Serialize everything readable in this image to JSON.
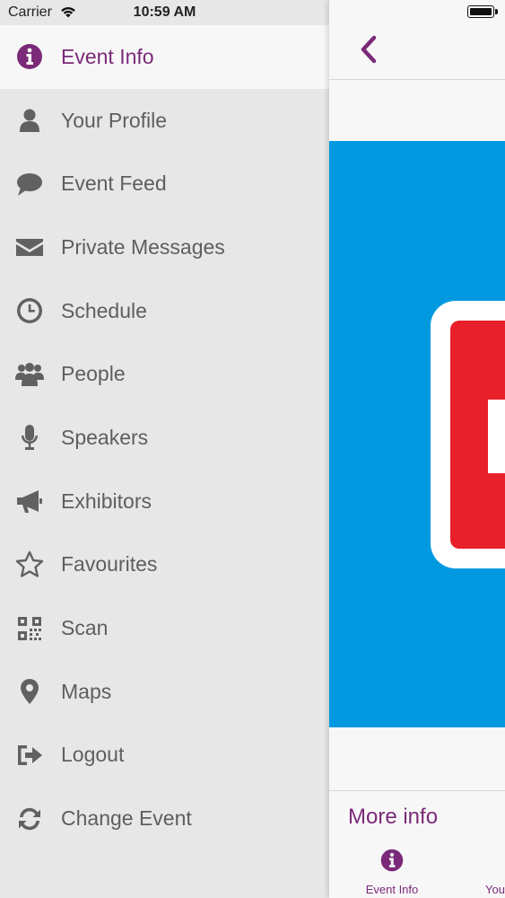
{
  "status_bar": {
    "carrier": "Carrier",
    "time": "10:59 AM"
  },
  "menu": {
    "items": [
      {
        "label": "Event Info",
        "icon": "info-circle-icon",
        "active": true
      },
      {
        "label": "Your Profile",
        "icon": "user-icon"
      },
      {
        "label": "Event Feed",
        "icon": "speech-bubble-icon"
      },
      {
        "label": "Private Messages",
        "icon": "envelope-icon"
      },
      {
        "label": "Schedule",
        "icon": "clock-icon"
      },
      {
        "label": "People",
        "icon": "group-icon"
      },
      {
        "label": "Speakers",
        "icon": "microphone-icon"
      },
      {
        "label": "Exhibitors",
        "icon": "megaphone-icon"
      },
      {
        "label": "Favourites",
        "icon": "star-outline-icon"
      },
      {
        "label": "Scan",
        "icon": "qr-code-icon"
      },
      {
        "label": "Maps",
        "icon": "map-pin-icon"
      },
      {
        "label": "Logout",
        "icon": "sign-out-icon"
      },
      {
        "label": "Change Event",
        "icon": "refresh-icon"
      }
    ]
  },
  "main": {
    "more_info": "More info",
    "tabs": [
      {
        "label": "Event Info",
        "icon": "info-circle-icon",
        "active": true
      },
      {
        "label": "You",
        "icon": "user-icon"
      }
    ]
  },
  "colors": {
    "accent": "#7a2a78",
    "banner": "#0099e0",
    "logo_red": "#e8202a",
    "menu_bg": "#e8e7e8",
    "icon_gray": "#616161"
  }
}
